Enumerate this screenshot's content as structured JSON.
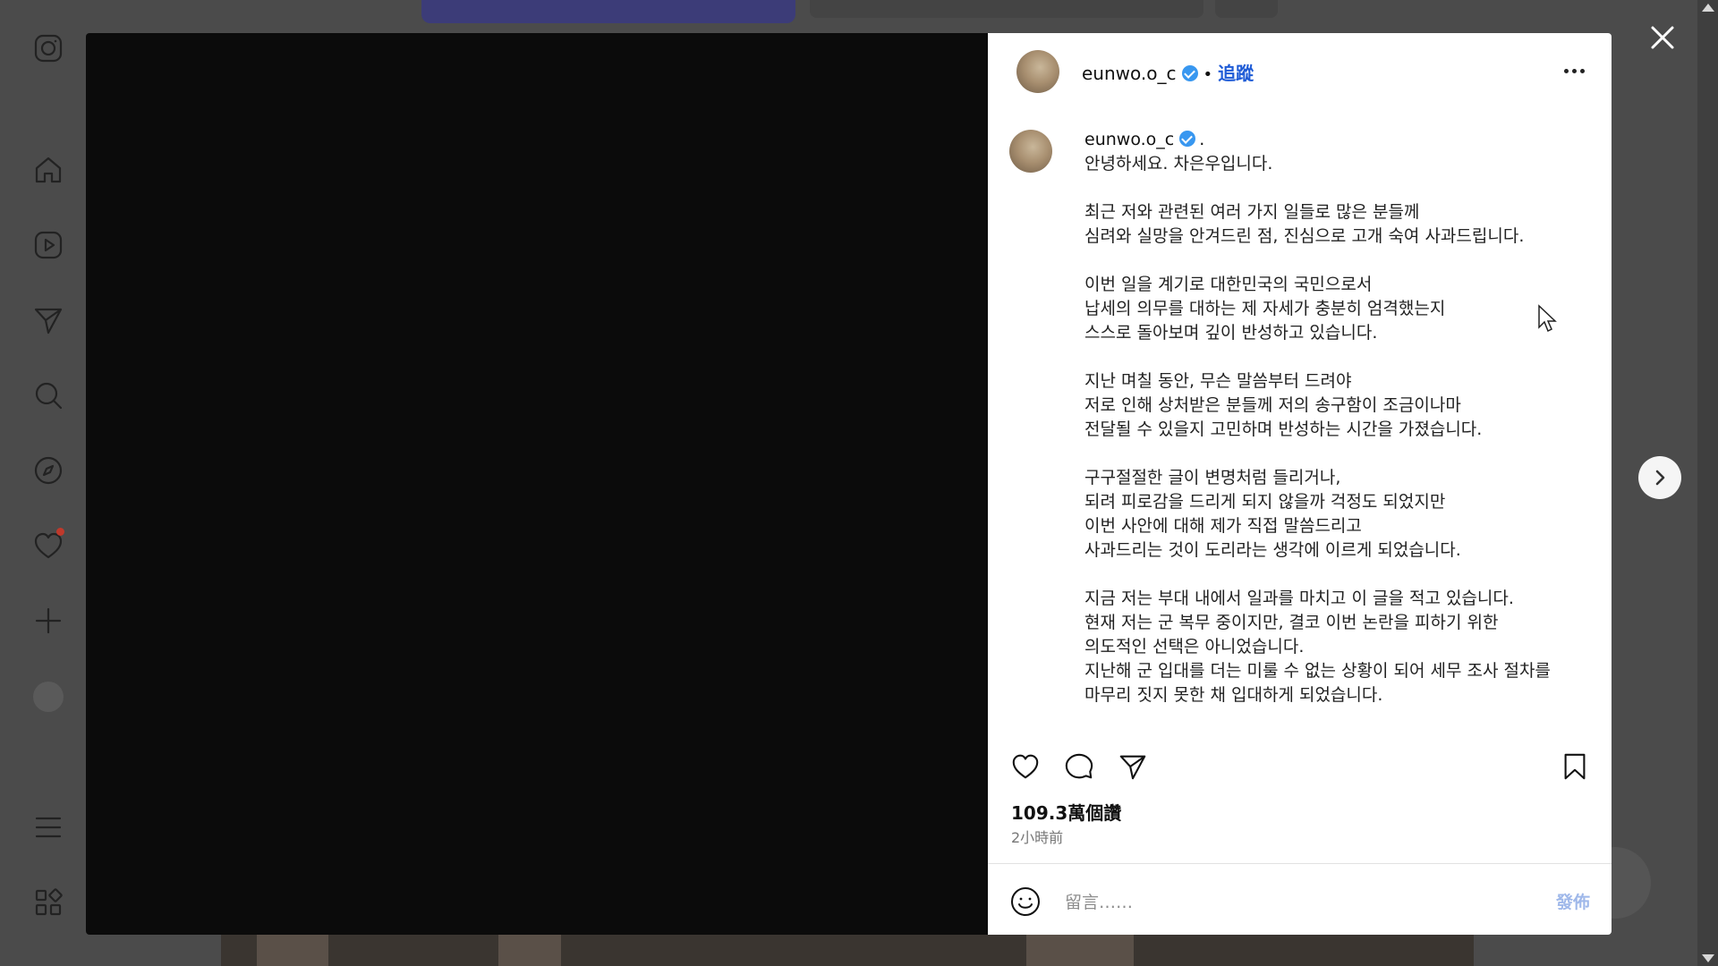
{
  "post": {
    "username": "eunwo.o_c",
    "follow_label": "追蹤",
    "separator": "•",
    "caption_dot": ".",
    "caption": "안녕하세요. 차은우입니다.\n\n최근 저와 관련된 여러 가지 일들로 많은 분들께\n심려와 실망을 안겨드린 점, 진심으로 고개 숙여 사과드립니다.\n\n이번 일을 계기로 대한민국의 국민으로서\n납세의 의무를 대하는 제 자세가 충분히 엄격했는지\n스스로 돌아보며 깊이 반성하고 있습니다.\n\n지난 며칠 동안, 무슨 말씀부터 드려야\n저로 인해 상처받은 분들께 저의 송구함이 조금이나마\n전달될 수 있을지 고민하며 반성하는 시간을 가졌습니다.\n\n구구절절한 글이 변명처럼 들리거나,\n되려 피로감을 드리게 되지 않을까 걱정도 되었지만\n이번 사안에 대해 제가 직접 말씀드리고\n사과드리는 것이 도리라는 생각에 이르게 되었습니다.\n\n지금 저는 부대 내에서 일과를 마치고 이 글을 적고 있습니다.\n현재 저는 군 복무 중이지만, 결코 이번 논란을 피하기 위한\n의도적인 선택은 아니었습니다.\n지난해 군 입대를 더는 미룰 수 없는 상황이 되어 세무 조사 절차를\n마무리 짓지 못한 채 입대하게 되었습니다.",
    "likes": "109.3萬個讚",
    "time_ago": "2小時前",
    "comment_placeholder": "留言……",
    "post_label": "發佈"
  },
  "icons": {
    "sidebar": [
      "instagram-icon",
      "home-icon",
      "reels-icon",
      "direct-icon",
      "search-icon",
      "explore-icon",
      "heart-icon",
      "create-icon",
      "profile-avatar",
      "menu-icon",
      "more-apps-icon"
    ],
    "actions": [
      "heart-icon",
      "comment-icon",
      "share-icon",
      "bookmark-icon"
    ]
  },
  "colors": {
    "follow": "#1e5bd6",
    "verified": "#3897f0",
    "notification": "#c0392b",
    "post_button": "#9fb8ea"
  }
}
